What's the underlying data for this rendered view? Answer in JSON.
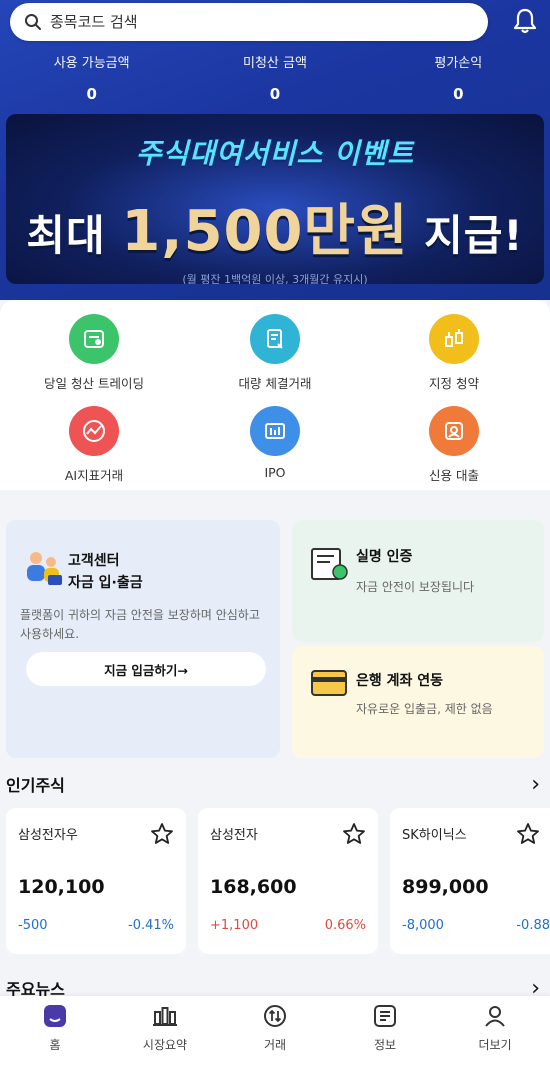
{
  "search": {
    "placeholder": "종목코드 검색"
  },
  "stats": [
    {
      "label": "사용 가능금액",
      "value": "0"
    },
    {
      "label": "미청산 금액",
      "value": "0"
    },
    {
      "label": "평가손익",
      "value": "0"
    }
  ],
  "banner": {
    "title": "주식대여서비스 이벤트",
    "main_prefix": "최대",
    "amount": "1,500만원",
    "main_suffix": "지급!",
    "sub": "(월 평잔 1백억원 이상, 3개월간 유지시)"
  },
  "quick_menu": [
    {
      "label": "당일 청산 트레이딩",
      "color": "#3cc46a",
      "icon": "day-trading-icon"
    },
    {
      "label": "대량 체결거래",
      "color": "#30b4d6",
      "icon": "bulk-trade-icon"
    },
    {
      "label": "지정 청약",
      "color": "#f1be1c",
      "icon": "subscription-icon"
    },
    {
      "label": "AI지표거래",
      "color": "#ee5453",
      "icon": "ai-indicator-icon"
    },
    {
      "label": "IPO",
      "color": "#3e8fe8",
      "icon": "ipo-icon"
    },
    {
      "label": "신용 대출",
      "color": "#f07a3a",
      "icon": "credit-loan-icon"
    }
  ],
  "cards": {
    "customer": {
      "title_line1": "고객센터",
      "title_line2": "자금 입·출금",
      "desc": "플랫폼이 귀하의 자금 안전을 보장하며 안심하고 사용하세요.",
      "button": "지금 입금하기→"
    },
    "verify": {
      "title": "실명 인증",
      "desc": "자금 안전이 보장됩니다"
    },
    "bank": {
      "title": "은행 계좌 연동",
      "desc": "자유로운 입출금, 제한 없음"
    }
  },
  "popular": {
    "title": "인기주식",
    "stocks": [
      {
        "name": "삼성전자우",
        "price": "120,100",
        "change": "-500",
        "percent": "-0.41%",
        "dir": "down"
      },
      {
        "name": "삼성전자",
        "price": "168,600",
        "change": "+1,100",
        "percent": "0.66%",
        "dir": "up"
      },
      {
        "name": "SK하이닉스",
        "price": "899,000",
        "change": "-8,000",
        "percent": "-0.88",
        "dir": "down"
      }
    ]
  },
  "news": {
    "title": "주요뉴스"
  },
  "nav": [
    {
      "label": "홈",
      "icon": "home-icon",
      "active": true
    },
    {
      "label": "시장요약",
      "icon": "market-summary-icon"
    },
    {
      "label": "거래",
      "icon": "trade-icon"
    },
    {
      "label": "정보",
      "icon": "info-icon"
    },
    {
      "label": "더보기",
      "icon": "more-icon"
    }
  ],
  "colors": {
    "header_bg": "#1b36a0",
    "up": "#e24a3b",
    "down": "#1f6fd1"
  }
}
